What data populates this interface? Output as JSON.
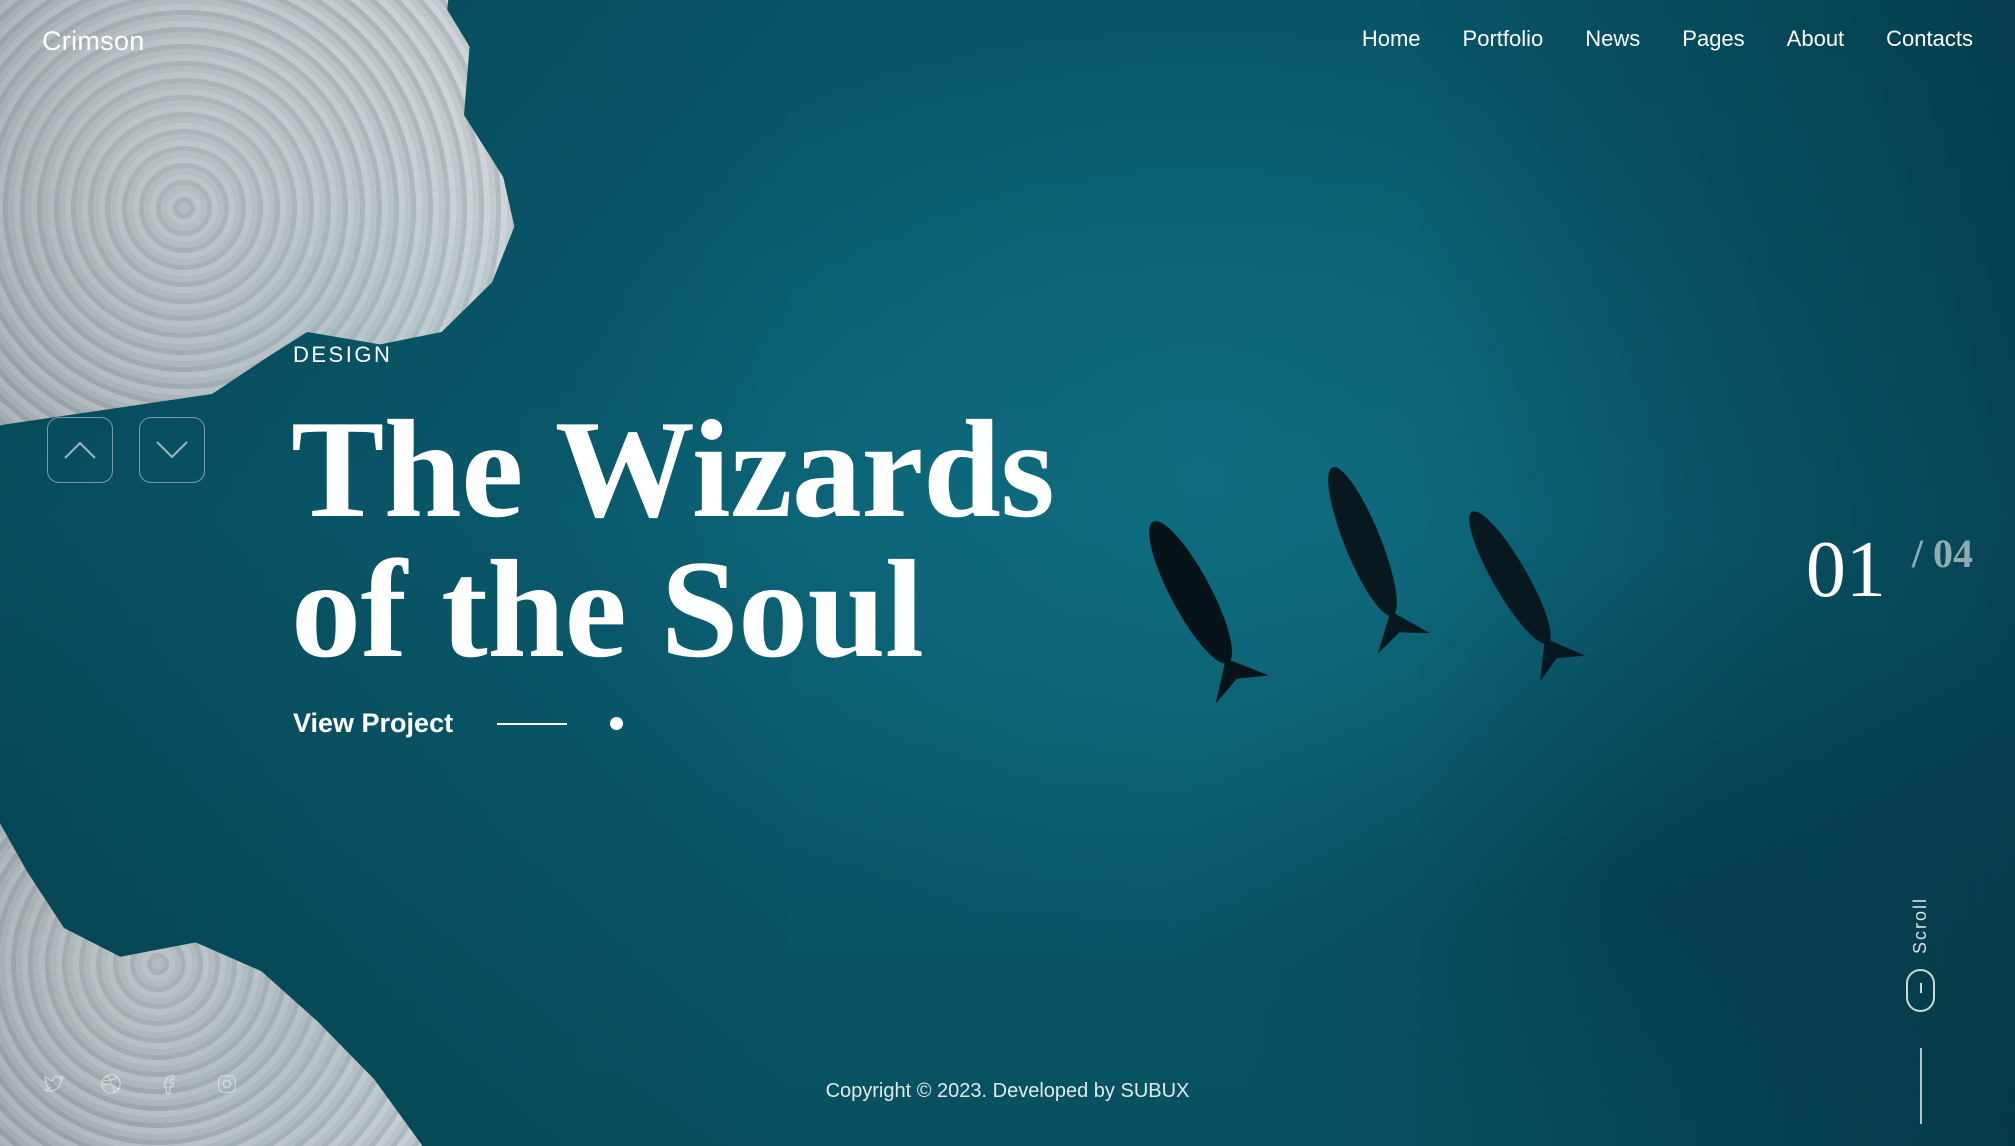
{
  "header": {
    "logo": "Crimson",
    "nav": [
      "Home",
      "Portfolio",
      "News",
      "Pages",
      "About",
      "Contacts"
    ]
  },
  "slider": {
    "prev_icon": "chevron-up-icon",
    "next_icon": "chevron-down-icon",
    "current": "01",
    "total": "/ 04"
  },
  "hero": {
    "category": "DESIGN",
    "title_line1": "The Wizards",
    "title_line2": "of the Soul",
    "cta_label": "View Project"
  },
  "scroll": {
    "label": "Scroll"
  },
  "social": [
    "twitter-icon",
    "dribbble-icon",
    "facebook-icon",
    "instagram-icon"
  ],
  "footer": {
    "copyright": "Copyright © 2023. Developed by SUBUX"
  },
  "colors": {
    "background": "#0b5a6b",
    "text": "#ffffff",
    "muted": "#9fb8bf"
  }
}
